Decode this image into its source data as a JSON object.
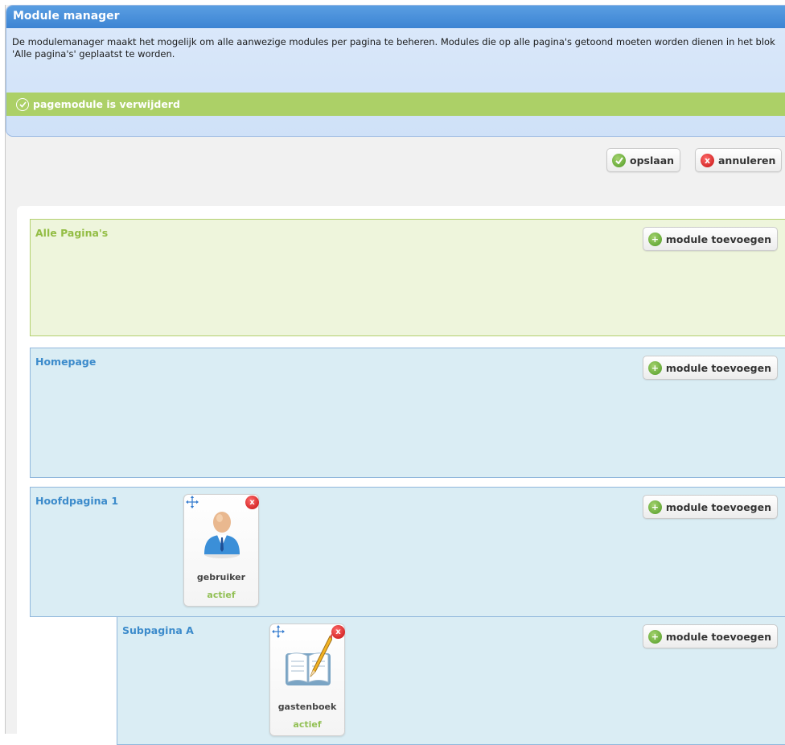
{
  "window": {
    "title": "Module manager"
  },
  "intro": {
    "text": "De modulemanager maakt het mogelijk om alle aanwezige modules per pagina te beheren. Modules die op alle pagina's getoond moeten worden dienen in het blok 'Alle pagina's' geplaatst te worden."
  },
  "notice": {
    "text": "pagemodule is verwijderd",
    "icon": "check-circle-icon"
  },
  "toolbar": {
    "save_label": "opslaan",
    "cancel_label": "annuleren"
  },
  "add_module_label": "module toevoegen",
  "blocks": [
    {
      "title": "Alle Pagina's"
    },
    {
      "title": "Homepage"
    },
    {
      "title": "Hoofdpagina 1"
    },
    {
      "title": "Subpagina A"
    }
  ],
  "modules": [
    {
      "name": "gebruiker",
      "status": "actief",
      "icon": "user-icon"
    },
    {
      "name": "gastenboek",
      "status": "actief",
      "icon": "guestbook-icon"
    }
  ],
  "colors": {
    "title_bar": "#3c84d3",
    "notice_bg": "#acd067",
    "all_pages_bg": "#eef5dc",
    "page_block_bg": "#daedf4",
    "status_green": "#92c055"
  }
}
